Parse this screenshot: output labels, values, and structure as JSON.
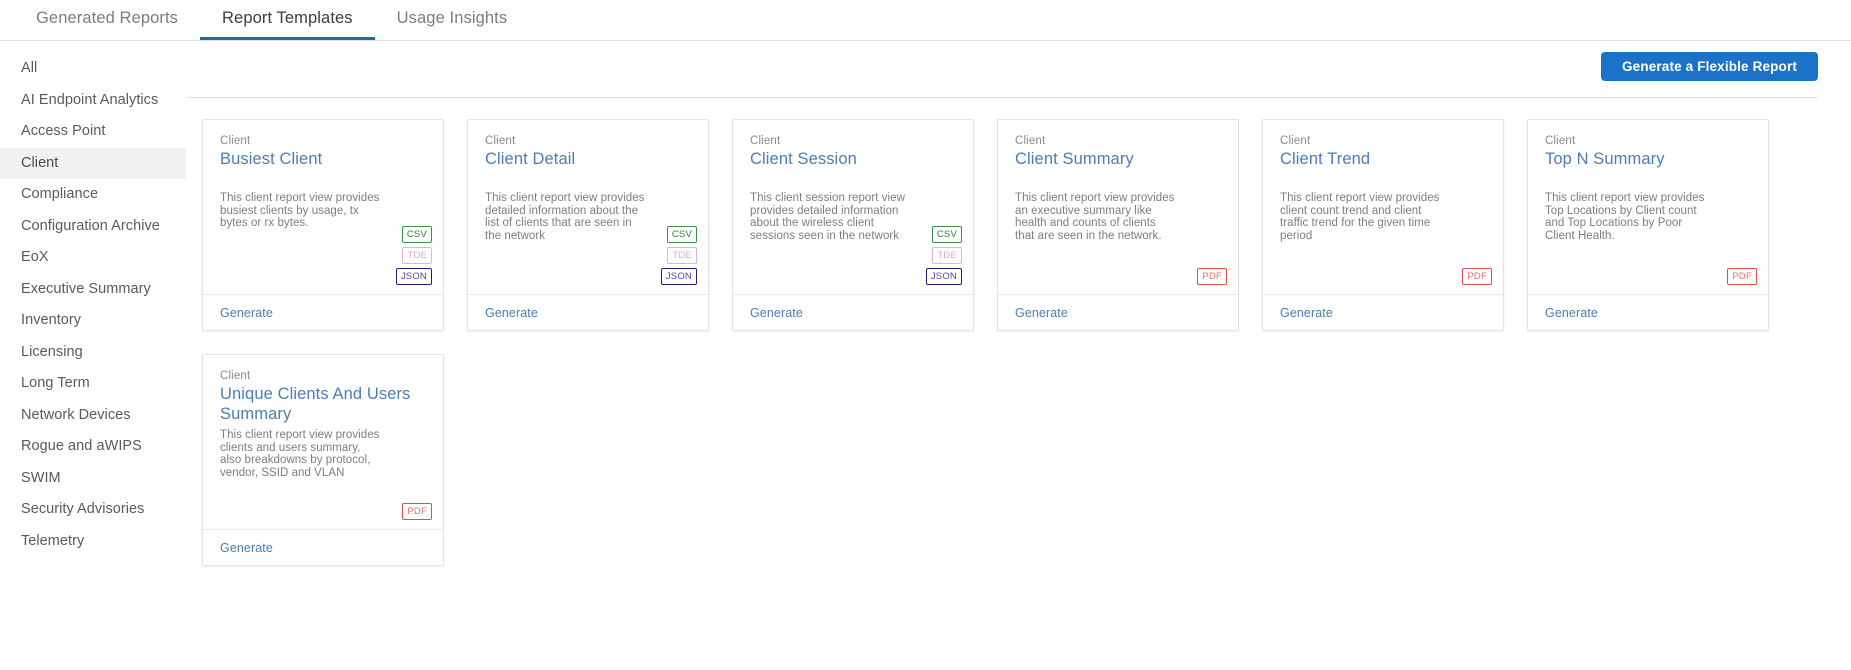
{
  "tabs": [
    {
      "label": "Generated Reports",
      "active": false
    },
    {
      "label": "Report Templates",
      "active": true
    },
    {
      "label": "Usage Insights",
      "active": false
    }
  ],
  "sidebar": {
    "items": [
      {
        "label": "All",
        "selected": false
      },
      {
        "label": "AI Endpoint Analytics",
        "selected": false
      },
      {
        "label": "Access Point",
        "selected": false
      },
      {
        "label": "Client",
        "selected": true
      },
      {
        "label": "Compliance",
        "selected": false
      },
      {
        "label": "Configuration Archive",
        "selected": false
      },
      {
        "label": "EoX",
        "selected": false
      },
      {
        "label": "Executive Summary",
        "selected": false
      },
      {
        "label": "Inventory",
        "selected": false
      },
      {
        "label": "Licensing",
        "selected": false
      },
      {
        "label": "Long Term",
        "selected": false
      },
      {
        "label": "Network Devices",
        "selected": false
      },
      {
        "label": "Rogue and aWIPS",
        "selected": false
      },
      {
        "label": "SWIM",
        "selected": false
      },
      {
        "label": "Security Advisories",
        "selected": false
      },
      {
        "label": "Telemetry",
        "selected": false
      }
    ]
  },
  "toolbar": {
    "generate_flexible_label": "Generate a Flexible Report"
  },
  "colors": {
    "accent_blue": "#1a73c8",
    "tab_underline": "#1b6bab",
    "card_title": "#4a7eb5",
    "badge_csv": "#3f8f4c",
    "badge_tde": "#e4b3d4",
    "badge_json": "#1f1f7a",
    "badge_pdf": "#e24c4c",
    "sidebar_selected_bg": "#f0f1f2"
  },
  "cards": [
    {
      "category": "Client",
      "title": "Busiest Client",
      "description": "This client report view provides busiest clients by usage, tx bytes or rx bytes.",
      "formats": [
        "CSV",
        "TDE",
        "JSON"
      ],
      "action": "Generate"
    },
    {
      "category": "Client",
      "title": "Client Detail",
      "description": "This client report view provides detailed information about the list of clients that are seen in the network",
      "formats": [
        "CSV",
        "TDE",
        "JSON"
      ],
      "action": "Generate"
    },
    {
      "category": "Client",
      "title": "Client Session",
      "description": "This client session report view provides detailed information about the wireless client sessions seen in the network",
      "formats": [
        "CSV",
        "TDE",
        "JSON"
      ],
      "action": "Generate"
    },
    {
      "category": "Client",
      "title": "Client Summary",
      "description": "This client report view provides an executive summary like health and counts of clients that are seen in the network.",
      "formats": [
        "PDF"
      ],
      "action": "Generate"
    },
    {
      "category": "Client",
      "title": "Client Trend",
      "description": "This client report view provides client count trend and client traffic trend for the given time period",
      "formats": [
        "PDF"
      ],
      "action": "Generate"
    },
    {
      "category": "Client",
      "title": "Top N Summary",
      "description": "This client report view provides Top Locations by Client count and Top Locations by Poor Client Health.",
      "formats": [
        "PDF"
      ],
      "action": "Generate"
    },
    {
      "category": "Client",
      "title": "Unique Clients And Users Summary",
      "description": "This client report view provides clients and users summary, also breakdowns by protocol, vendor, SSID and VLAN",
      "formats": [
        "PDF"
      ],
      "action": "Generate"
    }
  ]
}
